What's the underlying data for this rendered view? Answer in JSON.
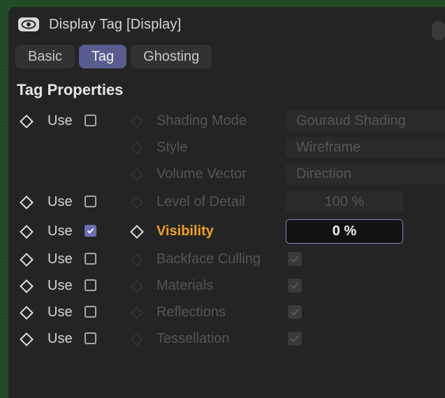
{
  "window": {
    "title": "Display Tag [Display]"
  },
  "tabs": [
    "Basic",
    "Tag",
    "Ghosting"
  ],
  "active_tab": "Tag",
  "section": {
    "title": "Tag Properties"
  },
  "use_label": "Use",
  "properties": [
    {
      "label": "Shading Mode",
      "value": "Gouraud Shading",
      "use": false,
      "show_use": true
    },
    {
      "label": "Style",
      "value": "Wireframe",
      "show_use": false
    },
    {
      "label": "Volume Vector",
      "value": "Direction",
      "show_use": false
    },
    {
      "label": "Level of Detail",
      "value": "100 %",
      "use": false,
      "show_use": true
    },
    {
      "label": "Visibility",
      "value": "0 %",
      "use": true,
      "show_use": true
    },
    {
      "label": "Backface Culling",
      "checked": true,
      "use": false,
      "show_use": true
    },
    {
      "label": "Materials",
      "checked": true,
      "use": false,
      "show_use": true
    },
    {
      "label": "Reflections",
      "checked": true,
      "use": false,
      "show_use": true
    },
    {
      "label": "Tessellation",
      "checked": true,
      "use": false,
      "show_use": true
    }
  ],
  "colors": {
    "accent": "#6b6fb5",
    "active_label": "#f0a020",
    "panel": "#242424"
  }
}
